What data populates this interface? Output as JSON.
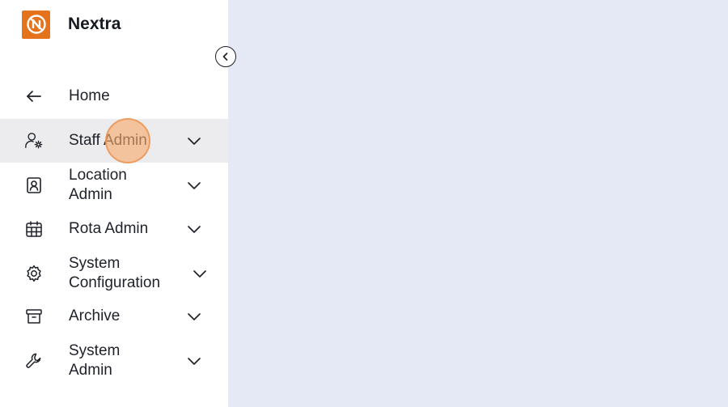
{
  "app": {
    "brand_name": "Nextra",
    "accent_color": "#e5731c",
    "content_background": "#e4e9f5"
  },
  "sidebar": {
    "collapse_icon": "chevron-left-circle-icon",
    "items": [
      {
        "label": "Home",
        "icon": "arrow-left-icon",
        "has_chevron": false,
        "active": false
      },
      {
        "label": "Staff Admin",
        "icon": "user-gear-icon",
        "has_chevron": true,
        "active": true
      },
      {
        "label": "Location\nAdmin",
        "icon": "id-badge-icon",
        "has_chevron": true,
        "active": false
      },
      {
        "label": "Rota Admin",
        "icon": "calendar-icon",
        "has_chevron": true,
        "active": false
      },
      {
        "label": "System\nConfiguration",
        "icon": "gear-icon",
        "has_chevron": true,
        "active": false
      },
      {
        "label": "Archive",
        "icon": "archive-box-icon",
        "has_chevron": true,
        "active": false
      },
      {
        "label": "System\nAdmin",
        "icon": "wrench-icon",
        "has_chevron": true,
        "active": false
      }
    ]
  }
}
